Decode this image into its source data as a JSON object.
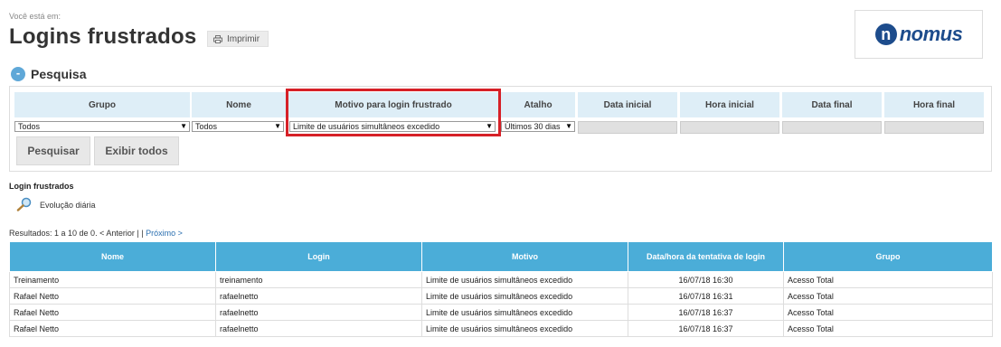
{
  "header": {
    "breadcrumb": "Você está em:",
    "title": "Logins frustrados",
    "print_label": "Imprimir",
    "logo_text": "nomus"
  },
  "search": {
    "section_title": "Pesquisa",
    "toggle_symbol": "-",
    "columns": [
      "Grupo",
      "Nome",
      "Motivo para login frustrado",
      "Atalho",
      "Data inicial",
      "Hora inicial",
      "Data final",
      "Hora final"
    ],
    "grupo_value": "Todos",
    "nome_value": "Todos",
    "motivo_value": "Limite de usuários simultâneos excedido",
    "atalho_value": "Últimos 30 dias",
    "search_button": "Pesquisar",
    "show_all_button": "Exibir todos",
    "highlight_color": "#d62027"
  },
  "results": {
    "section_label": "Login frustrados",
    "chart_link": "Evolução diária",
    "summary": "Resultados: 1 a 10 de 0.",
    "prev": "< Anterior",
    "separator": "| |",
    "next": "Próximo >",
    "columns": [
      "Nome",
      "Login",
      "Motivo",
      "Data/hora da tentativa de login",
      "Grupo"
    ],
    "header_color": "#4badd8",
    "rows": [
      [
        "Treinamento",
        "treinamento",
        "Limite de usuários simultâneos excedido",
        "16/07/18 16:30",
        "Acesso Total"
      ],
      [
        "Rafael Netto",
        "rafaelnetto",
        "Limite de usuários simultâneos excedido",
        "16/07/18 16:31",
        "Acesso Total"
      ],
      [
        "Rafael Netto",
        "rafaelnetto",
        "Limite de usuários simultâneos excedido",
        "16/07/18 16:37",
        "Acesso Total"
      ],
      [
        "Rafael Netto",
        "rafaelnetto",
        "Limite de usuários simultâneos excedido",
        "16/07/18 16:37",
        "Acesso Total"
      ]
    ]
  },
  "icons": {
    "printer": "printer-icon",
    "search": "magnifier-icon",
    "dropdown": "chevron-down-icon",
    "collapse": "minus-circle-icon"
  }
}
